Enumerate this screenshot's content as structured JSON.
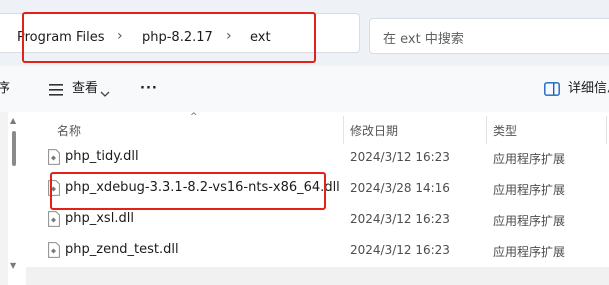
{
  "address_bar": {
    "breadcrumbs": [
      "Program Files",
      "php-8.2.17",
      "ext"
    ],
    "separator": "›"
  },
  "search": {
    "placeholder": "在 ext 中搜索"
  },
  "toolbar": {
    "cut_text": "序",
    "view_label": "查看",
    "more_label": "···",
    "details_label": "详细信息"
  },
  "columns": {
    "name": "名称",
    "modified": "修改日期",
    "type": "类型"
  },
  "files": [
    {
      "name": "php_tidy.dll",
      "modified": "2024/3/12 16:23",
      "type": "应用程序扩展"
    },
    {
      "name": "php_xdebug-3.3.1-8.2-vs16-nts-x86_64.dll",
      "modified": "2024/3/28 14:16",
      "type": "应用程序扩展"
    },
    {
      "name": "php_xsl.dll",
      "modified": "2024/3/12 16:23",
      "type": "应用程序扩展"
    },
    {
      "name": "php_zend_test.dll",
      "modified": "2024/3/12 16:23",
      "type": "应用程序扩展"
    }
  ],
  "colors": {
    "annotation_red": "#e1221b",
    "address_band": "#eef2f6"
  },
  "icons": [
    "view-icon",
    "more-icon",
    "details-pane-icon",
    "dll-file-icon",
    "sort-ascending-icon"
  ]
}
